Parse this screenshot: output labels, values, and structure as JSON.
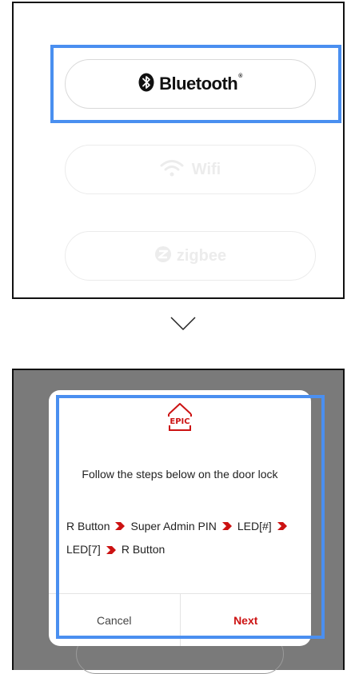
{
  "connection_options": {
    "bluetooth": {
      "label": "Bluetooth",
      "mark": "®"
    },
    "wifi": {
      "label": "Wifi"
    },
    "zigbee": {
      "label": "zigbee"
    }
  },
  "dialog": {
    "logo_text": "EPIC",
    "instruction": "Follow the steps below on the door lock",
    "steps": [
      "R Button",
      "Super Admin PIN",
      "LED[#]",
      "LED[7]",
      "R Button"
    ],
    "cancel_label": "Cancel",
    "next_label": "Next"
  },
  "colors": {
    "highlight": "#4a8ff0",
    "accent_red": "#cc1212",
    "overlay": "#7a7a7a"
  },
  "icons": [
    "bluetooth-icon",
    "wifi-icon",
    "zigbee-icon",
    "chevron-down-icon",
    "step-arrow-icon",
    "epic-logo-icon"
  ]
}
